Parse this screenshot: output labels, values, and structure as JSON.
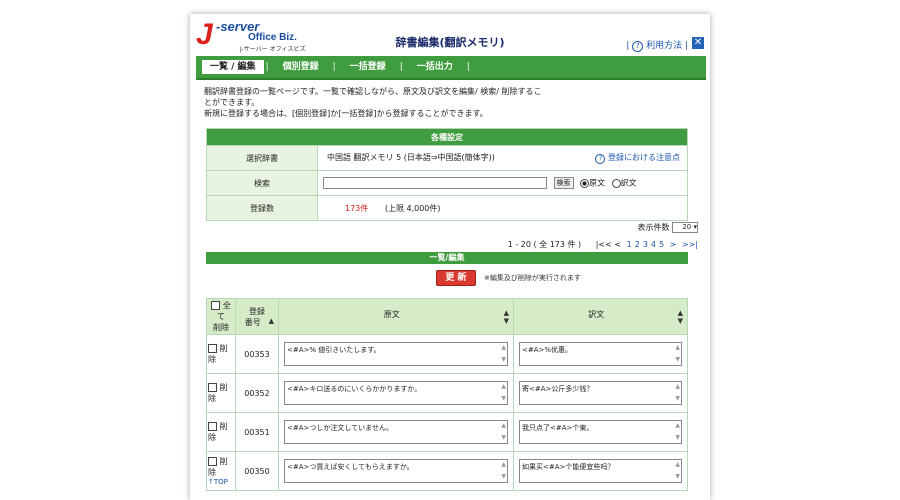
{
  "colors": {
    "green": "#3f9c3f",
    "light_green": "#e8f4e0",
    "red": "#d0201a",
    "link_blue": "#1a56b0"
  },
  "logo": {
    "mark": "J",
    "server": "-server",
    "office": "Office Biz.",
    "sub": "J-サーバー オフィスビズ"
  },
  "page_title": "辞書編集(翻訳メモリ)",
  "help": {
    "label": "利用方法",
    "icon": "question-icon"
  },
  "tabs": [
    {
      "label": "一覧 / 編集",
      "active": true
    },
    {
      "label": "個別登録"
    },
    {
      "label": "一括登録"
    },
    {
      "label": "一括出力"
    }
  ],
  "intro": {
    "line1": "翻訳辞書登録の一覧ページです。一覧で確認しながら、原文及び訳文を編集/ 検索/ 削除するこ",
    "line2": "とができます。",
    "line3": "新規に登録する場合は、[個別登録]か[一括登録]から登録することができます。"
  },
  "settings": {
    "heading": "各種設定",
    "dict_label": "選択辞書",
    "dict_value": "中国語 翻訳メモリ 5 (日本語⇒中国語(簡体字))",
    "note": "登録における注意点",
    "search_label": "検索",
    "search_button": "検索",
    "radio_source": "原文",
    "radio_target": "訳文",
    "count_label": "登録数",
    "count_value": "173件",
    "count_limit": "(上限 4,000件)"
  },
  "pager": {
    "per_page_label": "表示件数",
    "per_page_value": "20",
    "range": "1 - 20 ( 全 173 件 )",
    "first": "|<<",
    "prev": "<",
    "pages": [
      "1",
      "2",
      "3",
      "4",
      "5"
    ],
    "next": ">",
    "last": ">>|"
  },
  "list": {
    "heading": "一覧/編集",
    "update_button": "更 新",
    "update_note": "※編集及び削除が実行されます",
    "columns": {
      "delete_all": "全て\n削除",
      "number": "登録\n番号",
      "source": "原文",
      "target": "訳文"
    },
    "delete_label": "削除",
    "top_link": "↑TOP",
    "rows": [
      {
        "number": "00353",
        "source": "<#A>% 値引きいたします。",
        "target": "<#A>%优惠。"
      },
      {
        "number": "00352",
        "source": "<#A>キロ送るのにいくらかかりますか。",
        "target": "寄<#A>公斤多少钱？"
      },
      {
        "number": "00351",
        "source": "<#A>つしか注文していません。",
        "target": "我只点了<#A>个東。"
      },
      {
        "number": "00350",
        "source": "<#A>つ買えば安くしてもらえますか。",
        "target": "如果买<#A>个能便宜些吗？"
      }
    ]
  }
}
